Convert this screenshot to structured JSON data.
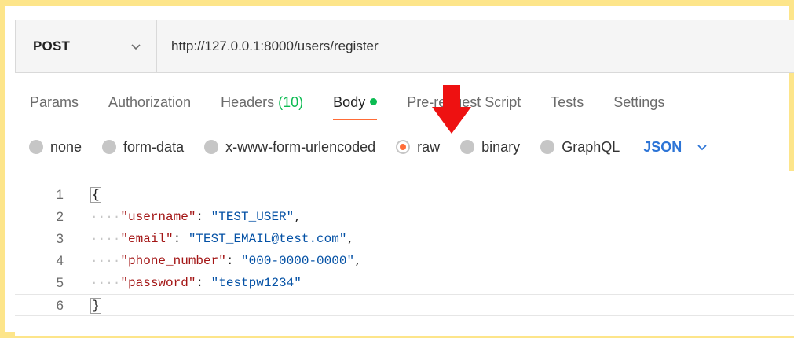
{
  "request": {
    "method": "POST",
    "url": "http://127.0.0.1:8000/users/register"
  },
  "tabs": [
    {
      "label": "Params"
    },
    {
      "label": "Authorization"
    },
    {
      "label": "Headers",
      "count": "(10)"
    },
    {
      "label": "Body",
      "active": true
    },
    {
      "label": "Pre-request Script"
    },
    {
      "label": "Tests"
    },
    {
      "label": "Settings"
    }
  ],
  "body_types": {
    "options": [
      "none",
      "form-data",
      "x-www-form-urlencoded",
      "raw",
      "binary",
      "GraphQL"
    ],
    "selected": "raw",
    "format": "JSON"
  },
  "editor": {
    "line_numbers": [
      "1",
      "2",
      "3",
      "4",
      "5",
      "6"
    ],
    "open_brace": "{",
    "close_brace": "}",
    "fields": [
      {
        "key": "\"username\"",
        "value": "\"TEST_USER\"",
        "comma": ","
      },
      {
        "key": "\"email\"",
        "value": "\"TEST_EMAIL@test.com\"",
        "comma": ","
      },
      {
        "key": "\"phone_number\"",
        "value": "\"000-0000-0000\"",
        "comma": ","
      },
      {
        "key": "\"password\"",
        "value": "\"testpw1234\"",
        "comma": ""
      }
    ],
    "indent_marker": "····"
  },
  "colors": {
    "accent": "#ff6c37",
    "frame": "#fde58a",
    "status_green": "#0cbb52",
    "link_blue": "#2c74d6",
    "arrow_red": "#ee1111"
  }
}
